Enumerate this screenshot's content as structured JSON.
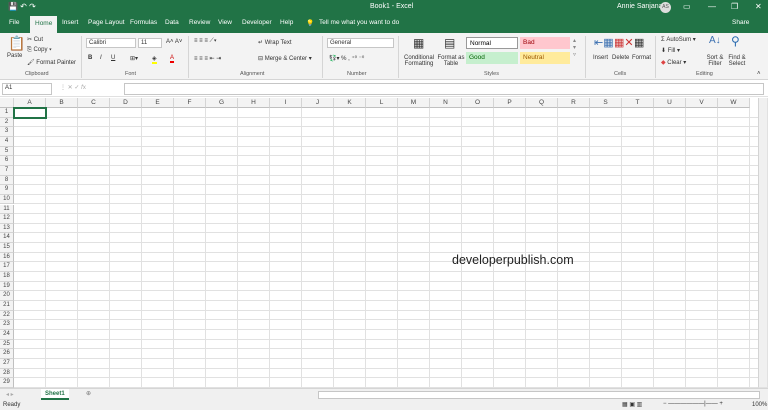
{
  "title": "Book1 - Excel",
  "user": {
    "name": "Annie Sanjana",
    "initials": "AS"
  },
  "tabs": [
    "File",
    "Home",
    "Insert",
    "Page Layout",
    "Formulas",
    "Data",
    "Review",
    "View",
    "Developer",
    "Help"
  ],
  "tell_me": "Tell me what you want to do",
  "share": "Share",
  "ribbon": {
    "clipboard": {
      "paste": "Paste",
      "cut": "Cut",
      "copy": "Copy",
      "format_painter": "Format Painter",
      "label": "Clipboard"
    },
    "font": {
      "name": "Calibri",
      "size": "11",
      "label": "Font"
    },
    "alignment": {
      "wrap": "Wrap Text",
      "merge": "Merge & Center",
      "label": "Alignment"
    },
    "number": {
      "format": "General",
      "label": "Number"
    },
    "styles": {
      "conditional": "Conditional Formatting",
      "format_table": "Format as Table",
      "normal": "Normal",
      "bad": "Bad",
      "good": "Good",
      "neutral": "Neutral",
      "label": "Styles"
    },
    "cells": {
      "insert": "Insert",
      "delete": "Delete",
      "format": "Format",
      "label": "Cells"
    },
    "editing": {
      "autosum": "AutoSum",
      "fill": "Fill",
      "clear": "Clear",
      "sort": "Sort & Filter",
      "find": "Find & Select",
      "label": "Editing"
    }
  },
  "name_box": "A1",
  "columns": [
    "A",
    "B",
    "C",
    "D",
    "E",
    "F",
    "G",
    "H",
    "I",
    "J",
    "K",
    "L",
    "M",
    "N",
    "O",
    "P",
    "Q",
    "R",
    "S",
    "T",
    "U",
    "V",
    "W"
  ],
  "rows": 29,
  "watermark": "developerpublish.com",
  "sheet_tab": "Sheet1",
  "status": {
    "ready": "Ready",
    "zoom": "100%"
  }
}
